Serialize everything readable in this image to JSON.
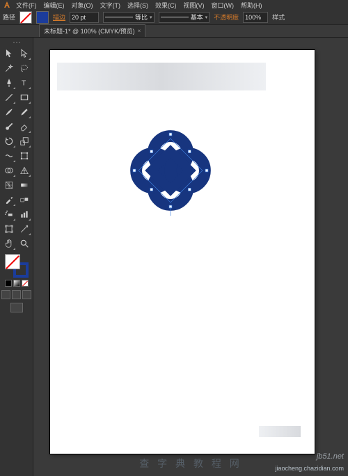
{
  "menubar": {
    "items": [
      "文件(F)",
      "编辑(E)",
      "对象(O)",
      "文字(T)",
      "选择(S)",
      "效果(C)",
      "视图(V)",
      "窗口(W)",
      "帮助(H)"
    ]
  },
  "controlbar": {
    "left_label": "路径",
    "stroke_label": "描边",
    "stroke_value": "20 pt",
    "profile_label": "等比",
    "brush_label": "基本",
    "opacity_label": "不透明度",
    "opacity_value": "100%",
    "style_label": "样式"
  },
  "tab": {
    "title": "未标题-1* @ 100% (CMYK/预览)"
  },
  "tools": {
    "names": [
      [
        "selection",
        "direct-selection"
      ],
      [
        "magic-wand",
        "lasso"
      ],
      [
        "pen",
        "type"
      ],
      [
        "line-segment",
        "rectangle"
      ],
      [
        "paintbrush",
        "pencil"
      ],
      [
        "blob-brush",
        "eraser"
      ],
      [
        "rotate",
        "scale"
      ],
      [
        "width",
        "free-transform"
      ],
      [
        "shape-builder",
        "perspective-grid"
      ],
      [
        "mesh",
        "gradient"
      ],
      [
        "eyedropper",
        "blend"
      ],
      [
        "symbol-sprayer",
        "column-graph"
      ],
      [
        "artboard",
        "slice"
      ],
      [
        "hand",
        "zoom"
      ]
    ]
  },
  "colors": {
    "knot": "#17357f",
    "selection": "#3d7fe0"
  },
  "watermarks": {
    "site": "jb51.net",
    "url": "jiaocheng.chazidian.com",
    "center": "查 字 典 教 程 网"
  }
}
